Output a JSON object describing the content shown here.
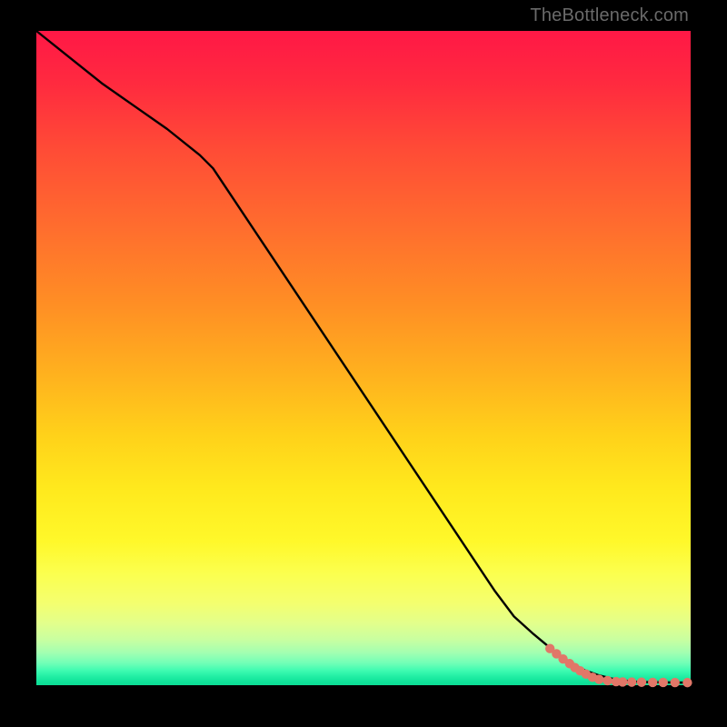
{
  "attribution": "TheBottleneck.com",
  "colors": {
    "background": "#000000",
    "marker": "#e17768",
    "curve": "#000000",
    "gradient_top": "#ff1846",
    "gradient_bottom": "#0cdc94",
    "attribution_text": "#6a6a6a"
  },
  "chart_data": {
    "type": "line",
    "title": "",
    "xlabel": "",
    "ylabel": "",
    "xlim": [
      0,
      100
    ],
    "ylim": [
      0,
      100
    ],
    "grid": false,
    "series": [
      {
        "name": "curve",
        "x": [
          0,
          5,
          10,
          15,
          20,
          25,
          27,
          30,
          35,
          40,
          45,
          50,
          55,
          60,
          65,
          70,
          73,
          76,
          79,
          82,
          84,
          86,
          88,
          90,
          92,
          95,
          98,
          100
        ],
        "y": [
          100,
          96,
          92,
          88.5,
          85,
          81,
          79,
          74.5,
          67,
          59.5,
          52,
          44.5,
          37,
          29.5,
          22,
          14.5,
          10.5,
          7.8,
          5.3,
          3.2,
          2.2,
          1.5,
          1.0,
          0.7,
          0.5,
          0.45,
          0.4,
          0.4
        ]
      }
    ],
    "markers": {
      "name": "highlight-points",
      "radius": 5.2,
      "points": [
        {
          "x": 78.5,
          "y": 5.6
        },
        {
          "x": 79.5,
          "y": 4.8
        },
        {
          "x": 80.5,
          "y": 4.0
        },
        {
          "x": 81.5,
          "y": 3.3
        },
        {
          "x": 82.3,
          "y": 2.7
        },
        {
          "x": 83.1,
          "y": 2.2
        },
        {
          "x": 84.0,
          "y": 1.7
        },
        {
          "x": 85.0,
          "y": 1.2
        },
        {
          "x": 86.0,
          "y": 0.9
        },
        {
          "x": 87.3,
          "y": 0.7
        },
        {
          "x": 88.6,
          "y": 0.55
        },
        {
          "x": 89.6,
          "y": 0.5
        },
        {
          "x": 91.0,
          "y": 0.47
        },
        {
          "x": 92.5,
          "y": 0.45
        },
        {
          "x": 94.2,
          "y": 0.43
        },
        {
          "x": 95.8,
          "y": 0.42
        },
        {
          "x": 97.6,
          "y": 0.41
        },
        {
          "x": 99.5,
          "y": 0.4
        }
      ]
    }
  }
}
